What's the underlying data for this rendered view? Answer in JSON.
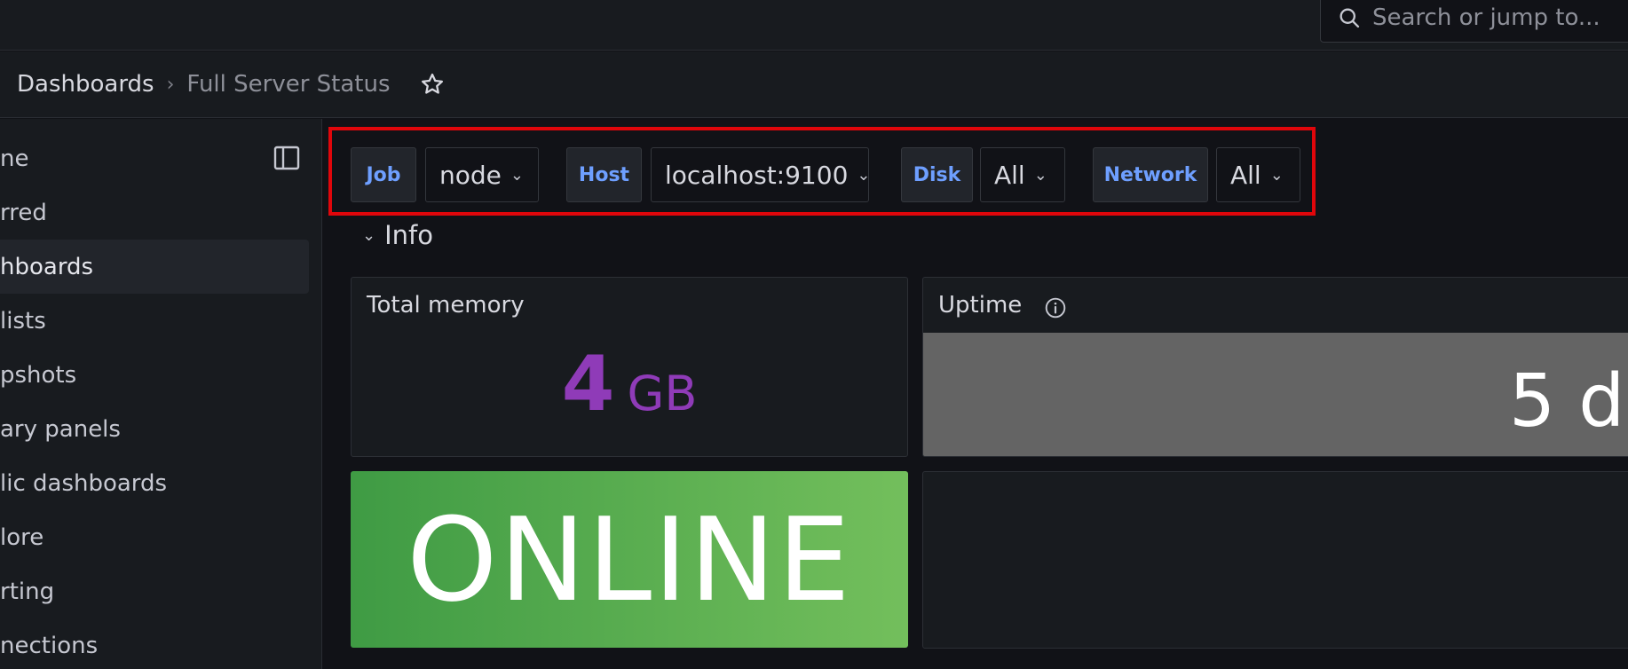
{
  "search": {
    "placeholder": "Search or jump to...",
    "icon": "search-icon"
  },
  "breadcrumb": {
    "parent": "Dashboards",
    "separator": "›",
    "current": "Full Server Status"
  },
  "sidebar": {
    "items": [
      {
        "label": "ne",
        "active": false
      },
      {
        "label": "rred",
        "active": false
      },
      {
        "label": "hboards",
        "active": true
      },
      {
        "label": "lists",
        "active": false
      },
      {
        "label": "pshots",
        "active": false
      },
      {
        "label": "ary panels",
        "active": false
      },
      {
        "label": "lic dashboards",
        "active": false
      },
      {
        "label": "lore",
        "active": false
      },
      {
        "label": "rting",
        "active": false
      },
      {
        "label": "nections",
        "active": false
      }
    ]
  },
  "variables": {
    "job": {
      "label": "Job",
      "value": "node"
    },
    "host": {
      "label": "Host",
      "value": "localhost:9100"
    },
    "disk": {
      "label": "Disk",
      "value": "All"
    },
    "network": {
      "label": "Network",
      "value": "All"
    }
  },
  "row": {
    "title": "Info"
  },
  "panels": {
    "total_memory": {
      "title": "Total memory",
      "value": "4",
      "unit": "GB",
      "color": "#8f3bb8"
    },
    "uptime": {
      "title": "Uptime",
      "value": "5 d",
      "color": "#646464"
    },
    "status": {
      "value": "ONLINE",
      "color": "#56a64b"
    }
  },
  "colors": {
    "accent": "#6e9fff",
    "highlight": "#e0060b"
  }
}
